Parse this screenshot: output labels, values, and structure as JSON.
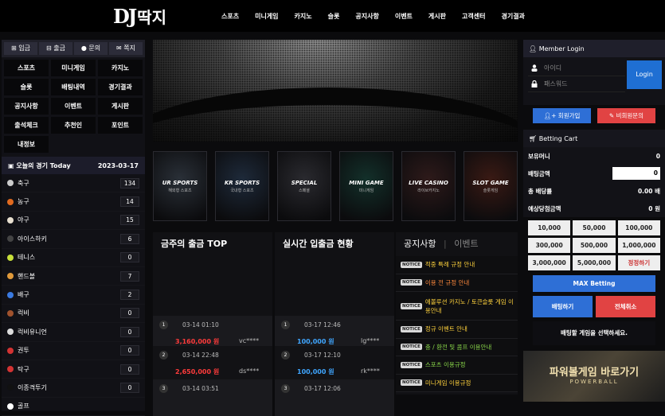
{
  "logo": {
    "latin": "DJ",
    "korean": "딱지"
  },
  "nav": [
    "스포츠",
    "미니게임",
    "카지노",
    "슬롯",
    "공지사항",
    "이벤트",
    "게시판",
    "고객센터",
    "경기결과"
  ],
  "quick": [
    {
      "label": "입금",
      "icon": "plus-square-icon"
    },
    {
      "label": "출금",
      "icon": "minus-square-icon"
    },
    {
      "label": "문의",
      "icon": "question-circle-icon"
    },
    {
      "label": "쪽지",
      "icon": "envelope-icon"
    }
  ],
  "menu": [
    "스포츠",
    "미니게임",
    "카지노",
    "슬롯",
    "배팅내역",
    "경기결과",
    "공지사항",
    "이벤트",
    "게시판",
    "출석체크",
    "추천인",
    "포인트",
    "내정보"
  ],
  "today": {
    "title": "오늘의 경기 Today",
    "date": "2023-03-17"
  },
  "sports": [
    {
      "name": "축구",
      "count": "134",
      "color": "#cccccc"
    },
    {
      "name": "농구",
      "count": "14",
      "color": "#e06a1f"
    },
    {
      "name": "야구",
      "count": "15",
      "color": "#e8e0d0"
    },
    {
      "name": "아이스하키",
      "count": "6",
      "color": "#444444"
    },
    {
      "name": "테니스",
      "count": "0",
      "color": "#c8e03a"
    },
    {
      "name": "핸드볼",
      "count": "7",
      "color": "#e09a3a"
    },
    {
      "name": "배구",
      "count": "2",
      "color": "#3a7ae0"
    },
    {
      "name": "럭비",
      "count": "0",
      "color": "#a0522d"
    },
    {
      "name": "럭비유니언",
      "count": "0",
      "color": "#dddddd"
    },
    {
      "name": "권투",
      "count": "0",
      "color": "#d33333"
    },
    {
      "name": "탁구",
      "count": "0",
      "color": "#d33333"
    },
    {
      "name": "이종격투기",
      "count": "0",
      "color": "#111111"
    },
    {
      "name": "골프",
      "count": "",
      "color": "#ffffff"
    }
  ],
  "categories": [
    {
      "title": "UR SPORTS",
      "sub": "해외형 스포츠",
      "bg": "#2a3038"
    },
    {
      "title": "KR SPORTS",
      "sub": "국내형 스포츠",
      "bg": "#1e2a3a"
    },
    {
      "title": "SPECIAL",
      "sub": "스페셜",
      "bg": "#2a2a2f"
    },
    {
      "title": "MINI GAME",
      "sub": "미니게임",
      "bg": "#13302a"
    },
    {
      "title": "LIVE CASINO",
      "sub": "라이브카지노",
      "bg": "#2e1a1a"
    },
    {
      "title": "SLOT GAME",
      "sub": "슬롯게임",
      "bg": "#3a1a14"
    }
  ],
  "withdraw": {
    "title": "금주의 출금 TOP",
    "rows": [
      {
        "rank": "1",
        "date": "03-14 01:10",
        "amount": "3,160,000 원",
        "user": "vc****"
      },
      {
        "rank": "2",
        "date": "03-14 22:48",
        "amount": "2,650,000 원",
        "user": "ds****"
      },
      {
        "rank": "3",
        "date": "03-14 03:51",
        "amount": "",
        "user": ""
      }
    ]
  },
  "realtime": {
    "title": "실시간 입출금 현황",
    "rows": [
      {
        "rank": "1",
        "date": "03-17 12:46",
        "amount": "100,000 원",
        "user": "lg****"
      },
      {
        "rank": "2",
        "date": "03-17 12:10",
        "amount": "100,000 원",
        "user": "rk****"
      },
      {
        "rank": "3",
        "date": "03-17 12:06",
        "amount": "",
        "user": ""
      }
    ]
  },
  "board": {
    "tab_notice": "공지사항",
    "tab_sep": "|",
    "tab_event": "이벤트",
    "badge": "NOTICE",
    "items": [
      "적중 특례 규정 안내",
      "이용 전 규정 안내",
      "에볼루션 카지노 / 토큰슬롯 게임 이용안내",
      "정규 이벤트 안내",
      "충 / 환전 및 콤프 이용안내",
      "스포츠 이용규정",
      "미니게임 이용규정"
    ]
  },
  "login": {
    "title": "Member Login",
    "id_placeholder": "아이디",
    "pw_placeholder": "패스워드",
    "button": "Login",
    "join": "회원가입",
    "guest": "비회원문의"
  },
  "cart": {
    "title": "Betting Cart",
    "holding_label": "보유머니",
    "holding": "0",
    "bet_label": "배팅금액",
    "bet_value": "0",
    "odds_label": "총 배당률",
    "odds": "0.00 배",
    "expected_label": "예상당첨금액",
    "expected": "0 원",
    "amounts": [
      "10,000",
      "50,000",
      "100,000",
      "300,000",
      "500,000",
      "1,000,000",
      "3,000,000",
      "5,000,000",
      "정정하기"
    ],
    "max": "MAX Betting",
    "bet": "배팅하기",
    "cancel": "전체취소",
    "message": "배팅할 게임을 선택하세요."
  },
  "powerball": {
    "title": "파워볼게임 바로가기",
    "sub": "POWERBALL"
  },
  "colors": {
    "blue": "#2e6fd6",
    "red": "#e14343",
    "amount_red": "#ff3b3b",
    "amount_blue": "#3fa6ff",
    "notice_yellow": "#ffd23c"
  }
}
